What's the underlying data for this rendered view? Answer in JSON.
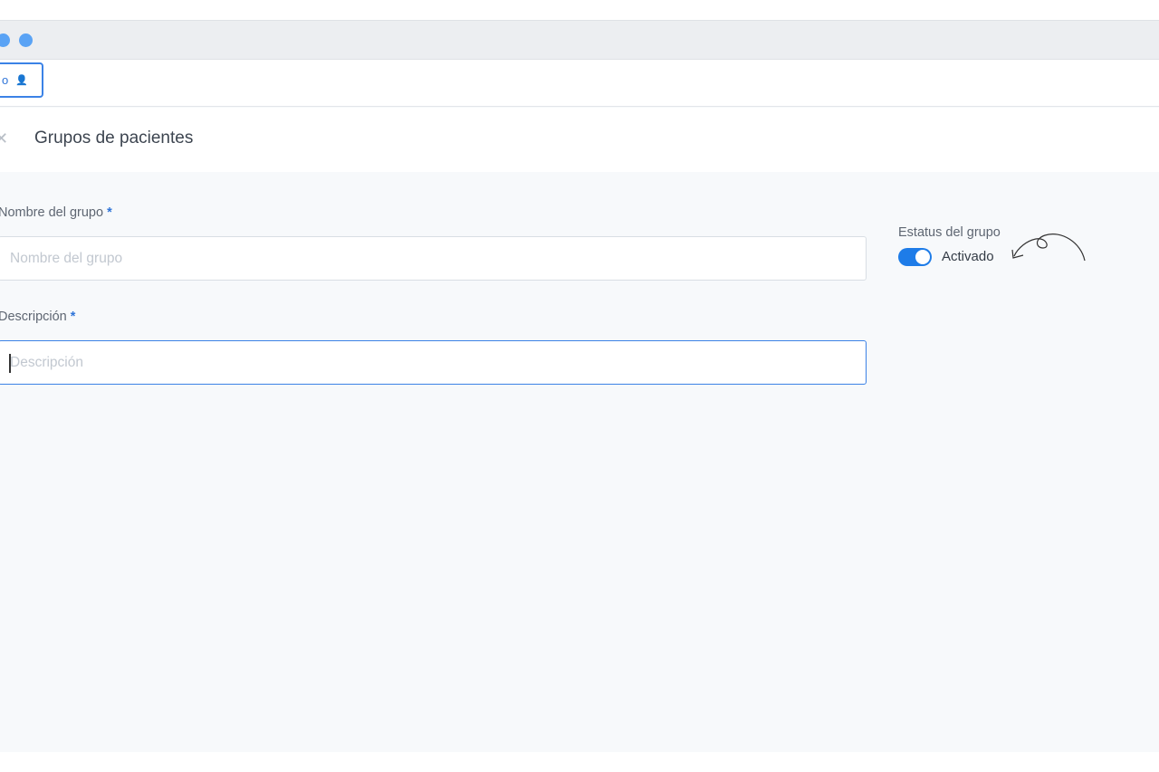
{
  "topbar": {
    "chip_text": "o",
    "chip_icon": "person-icon"
  },
  "header": {
    "title": "Grupos de pacientes",
    "back_icon": "close-icon"
  },
  "form": {
    "name_label": "Nombre del grupo",
    "name_required": "*",
    "name_placeholder": "Nombre del grupo",
    "desc_label": "Descripción",
    "desc_required": "*",
    "desc_placeholder": "Descripción"
  },
  "status": {
    "label": "Estatus del grupo",
    "toggle_label": "Activado"
  },
  "colors": {
    "accent": "#1e7ce8",
    "background": "#f7f9fb"
  }
}
